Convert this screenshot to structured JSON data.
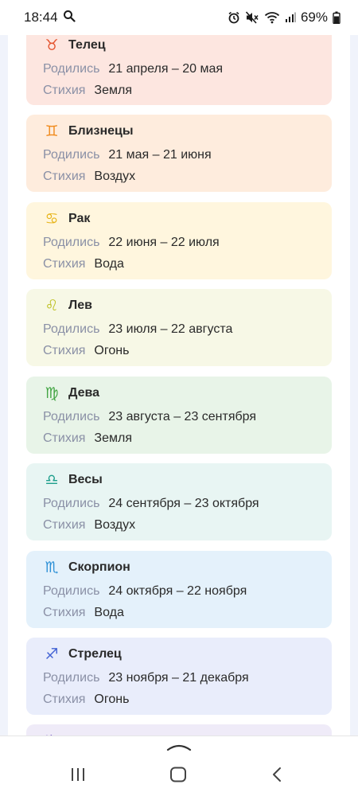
{
  "status_bar": {
    "time": "18:44",
    "battery_percent": "69%",
    "icons": [
      "search-icon",
      "alarm-icon",
      "mute-icon",
      "wifi-icon",
      "signal-icon",
      "battery-icon"
    ]
  },
  "cards": [
    {
      "id": "taurus",
      "symbol": "♉",
      "title": "Телец",
      "born_label": "Родились",
      "born": "21 апреля – 20 мая",
      "element_label": "Стихия",
      "element": "Земля",
      "bg": "#fde6e0",
      "icon_color": "#e4542f"
    },
    {
      "id": "gemini",
      "symbol": "♊",
      "title": "Близнецы",
      "born_label": "Родились",
      "born": "21 мая – 21 июня",
      "element_label": "Стихия",
      "element": "Воздух",
      "bg": "#feecdd",
      "icon_color": "#f08a1c"
    },
    {
      "id": "cancer",
      "symbol": "♋",
      "title": "Рак",
      "born_label": "Родились",
      "born": "22 июня – 22 июля",
      "element_label": "Стихия",
      "element": "Вода",
      "bg": "#fff6de",
      "icon_color": "#e7b418"
    },
    {
      "id": "leo",
      "symbol": "♌",
      "title": "Лев",
      "born_label": "Родились",
      "born": "23 июля – 22 августа",
      "element_label": "Стихия",
      "element": "Огонь",
      "bg": "#f7f8e6",
      "icon_color": "#bfc227"
    },
    {
      "id": "virgo",
      "symbol": "♍",
      "title": "Дева",
      "born_label": "Родились",
      "born": "23 августа – 23 сентября",
      "element_label": "Стихия",
      "element": "Земля",
      "bg": "#e8f4e8",
      "icon_color": "#43a544"
    },
    {
      "id": "libra",
      "symbol": "♎",
      "title": "Весы",
      "born_label": "Родились",
      "born": "24 сентября – 23 октября",
      "element_label": "Стихия",
      "element": "Воздух",
      "bg": "#e8f5f3",
      "icon_color": "#1e9e8c"
    },
    {
      "id": "scorpio",
      "symbol": "♏",
      "title": "Скорпион",
      "born_label": "Родились",
      "born": "24 октября – 22 ноября",
      "element_label": "Стихия",
      "element": "Вода",
      "bg": "#e4f1fb",
      "icon_color": "#2b8fd6"
    },
    {
      "id": "sagittarius",
      "symbol": "♐",
      "title": "Стрелец",
      "born_label": "Родились",
      "born": "23 ноября – 21 декабря",
      "element_label": "Стихия",
      "element": "Огонь",
      "bg": "#e9edfb",
      "icon_color": "#4262d4"
    },
    {
      "id": "capricorn",
      "symbol": "♑",
      "title": "",
      "born_label": "",
      "born": "",
      "element_label": "",
      "element": "",
      "bg": "#efebf8",
      "icon_color": "#6a4bc4"
    }
  ],
  "navigation_bar": {
    "icons": [
      "chevron-up-icon",
      "recents-icon",
      "home-icon",
      "back-icon"
    ]
  }
}
